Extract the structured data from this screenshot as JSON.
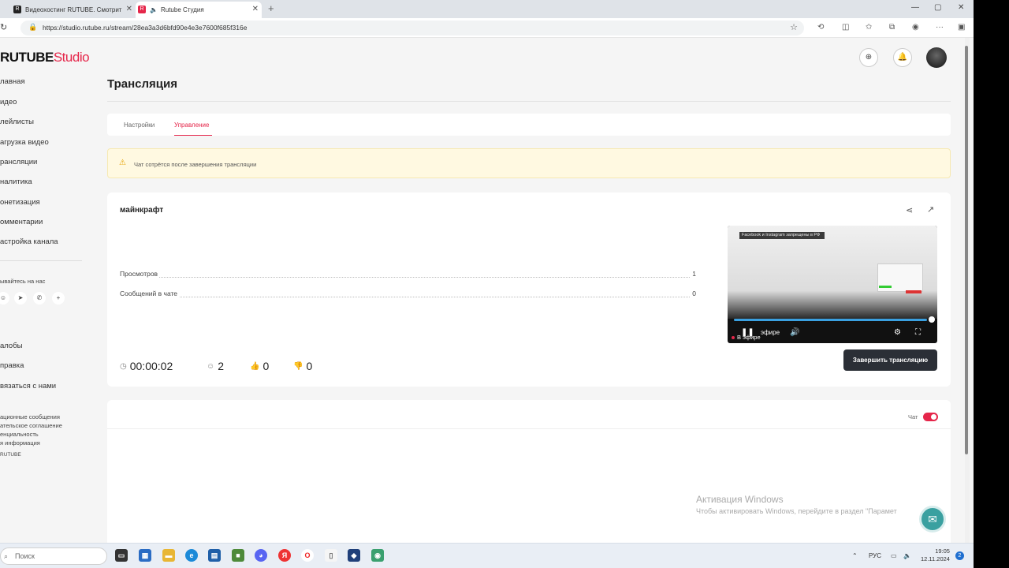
{
  "browser": {
    "tabs": [
      {
        "title": "Видеохостинг RUTUBE. Смотрит",
        "favicon": "R",
        "close": "✕"
      },
      {
        "title": "Rutube Студия",
        "favicon": "R",
        "close": "✕"
      }
    ],
    "new_tab": "+",
    "url": "https://studio.rutube.ru/stream/28ea3a3d6bfd90e4e3e7600f685f316e"
  },
  "brand": {
    "name": "RUTUBE",
    "product": "Studio",
    "accent": "#e5264a"
  },
  "sidebar": {
    "items": [
      {
        "label": "лавная"
      },
      {
        "label": "идео"
      },
      {
        "label": "лейлисты"
      },
      {
        "label": "агрузка видео"
      },
      {
        "label": "рансляции"
      },
      {
        "label": "налитика"
      },
      {
        "label": "онетизация"
      },
      {
        "label": "омментарии"
      },
      {
        "label": "астройка канала"
      }
    ],
    "social_label": "ывайтесь на нас",
    "social_more": "+",
    "bottom_items": [
      {
        "label": "алобы"
      },
      {
        "label": "правка"
      },
      {
        "label": "вязаться с нами"
      }
    ],
    "footer_links": [
      "ационные сообщения",
      "ательское соглашение",
      "енциальность",
      "я информация",
      "RUTUBE"
    ]
  },
  "page": {
    "title": "Трансляция",
    "tabs": [
      {
        "label": "Настройки",
        "active": false
      },
      {
        "label": "Управление",
        "active": true
      }
    ],
    "warning": "Чат сотрётся после завершения трансляции"
  },
  "stream": {
    "name": "майнкрафт",
    "stats": [
      {
        "label": "Просмотров",
        "value": "1"
      },
      {
        "label": "Сообщений в чате",
        "value": "0"
      }
    ],
    "duration": "00:00:02",
    "viewers": "2",
    "likes": "0",
    "dislikes": "0",
    "end_button": "Завершить трансляцию",
    "player": {
      "live_label": "В эфире",
      "overlay_label": "эфире",
      "banner": "Facebook и Instagram запрещены в РФ",
      "progress": 0.98
    }
  },
  "chat": {
    "label": "Чат",
    "enabled": true
  },
  "watermark": {
    "title": "Активация Windows",
    "subtitle": "Чтобы активировать Windows, перейдите в раздел \"Парамет"
  },
  "taskbar": {
    "search_placeholder": "Поиск",
    "language": "РУС",
    "time": "19:05",
    "date": "12.11.2024",
    "notifications": "2"
  }
}
